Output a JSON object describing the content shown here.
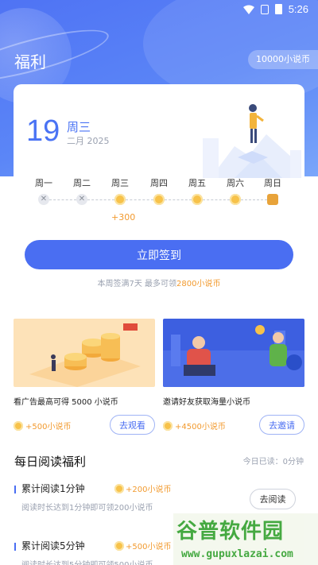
{
  "status_bar": {
    "time": "5:26"
  },
  "header": {
    "title": "福利",
    "coin_balance": "10000小说币"
  },
  "signin_card": {
    "day": "19",
    "weekday": "周三",
    "month_year": "二月 2025",
    "days": [
      {
        "label": "周一",
        "state": "missed"
      },
      {
        "label": "周二",
        "state": "missed"
      },
      {
        "label": "周三",
        "state": "coin"
      },
      {
        "label": "周四",
        "state": "coin"
      },
      {
        "label": "周五",
        "state": "coin"
      },
      {
        "label": "周六",
        "state": "coin"
      },
      {
        "label": "周日",
        "state": "gift"
      }
    ],
    "today_bonus": "+300"
  },
  "signin_button": "立即签到",
  "signin_note": {
    "prefix": "本周签满7天 最多可领",
    "highlight": "2800小说币"
  },
  "promos": [
    {
      "desc": "看广告最高可得 5000 小说币",
      "reward": "+500小说币",
      "button": "去观看"
    },
    {
      "desc": "邀请好友获取海量小说币",
      "reward": "+4500小说币",
      "button": "去邀请"
    }
  ],
  "daily_reading": {
    "title": "每日阅读福利",
    "today_read": "今日已读：0分钟",
    "tasks": [
      {
        "name": "累计阅读1分钟",
        "reward": "+200小说币",
        "desc": "阅读时长达到1分钟即可领200小说币",
        "button": "去阅读"
      },
      {
        "name": "累计阅读5分钟",
        "reward": "+500小说币",
        "desc": "阅读时长达到5分钟即可领500小说币",
        "button": ""
      }
    ]
  },
  "watermark": {
    "title": "谷普软件园",
    "url": "www.gupuxlazai.com"
  },
  "colors": {
    "primary": "#4a6ef2",
    "accent": "#f29a2e",
    "hero": "#5b86f7"
  }
}
